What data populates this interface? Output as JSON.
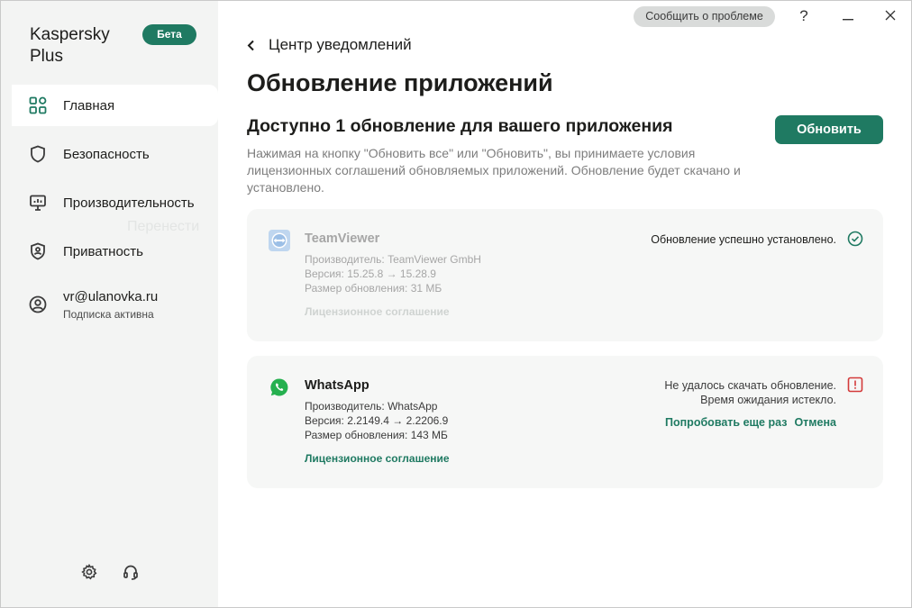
{
  "brand": {
    "name": "Kaspersky Plus",
    "badge": "Бета"
  },
  "sidebar": {
    "items": [
      {
        "label": "Главная"
      },
      {
        "label": "Безопасность"
      },
      {
        "label": "Производительность"
      },
      {
        "label": "Приватность"
      }
    ],
    "account": {
      "email": "vr@ulanovka.ru",
      "subscription": "Подписка активна"
    },
    "ghost_text": "Перенести"
  },
  "titlebar": {
    "report_label": "Сообщить о проблеме",
    "help": "?",
    "minimize": "—",
    "close": "✕"
  },
  "breadcrumb": {
    "label": "Центр уведомлений"
  },
  "page": {
    "title": "Обновление приложений",
    "section_title": "Доступно 1 обновление для вашего приложения",
    "update_button": "Обновить",
    "description": "Нажимая на кнопку \"Обновить все\" или \"Обновить\", вы принимаете условия лицензионных соглашений обновляемых приложений. Обновление будет скачано и установлено."
  },
  "apps": [
    {
      "name": "TeamViewer",
      "vendor": "Производитель: TeamViewer GmbH",
      "version": "Версия: 15.25.8 → 15.28.9",
      "size": "Размер обновления: 31 МБ",
      "license": "Лицензионное соглашение",
      "status": "Обновление успешно установлено."
    },
    {
      "name": "WhatsApp",
      "vendor": "Производитель: WhatsApp",
      "version": "Версия: 2.2149.4 → 2.2206.9",
      "size": "Размер обновления: 143 МБ",
      "license": "Лицензионное соглашение",
      "status": "Не удалось скачать обновление. Время ожидания истекло.",
      "retry": "Попробовать еще раз",
      "cancel": "Отмена"
    }
  ],
  "colors": {
    "accent": "#1f7a62",
    "error": "#d33a3a",
    "sidebar_bg": "#f3f4f3"
  }
}
